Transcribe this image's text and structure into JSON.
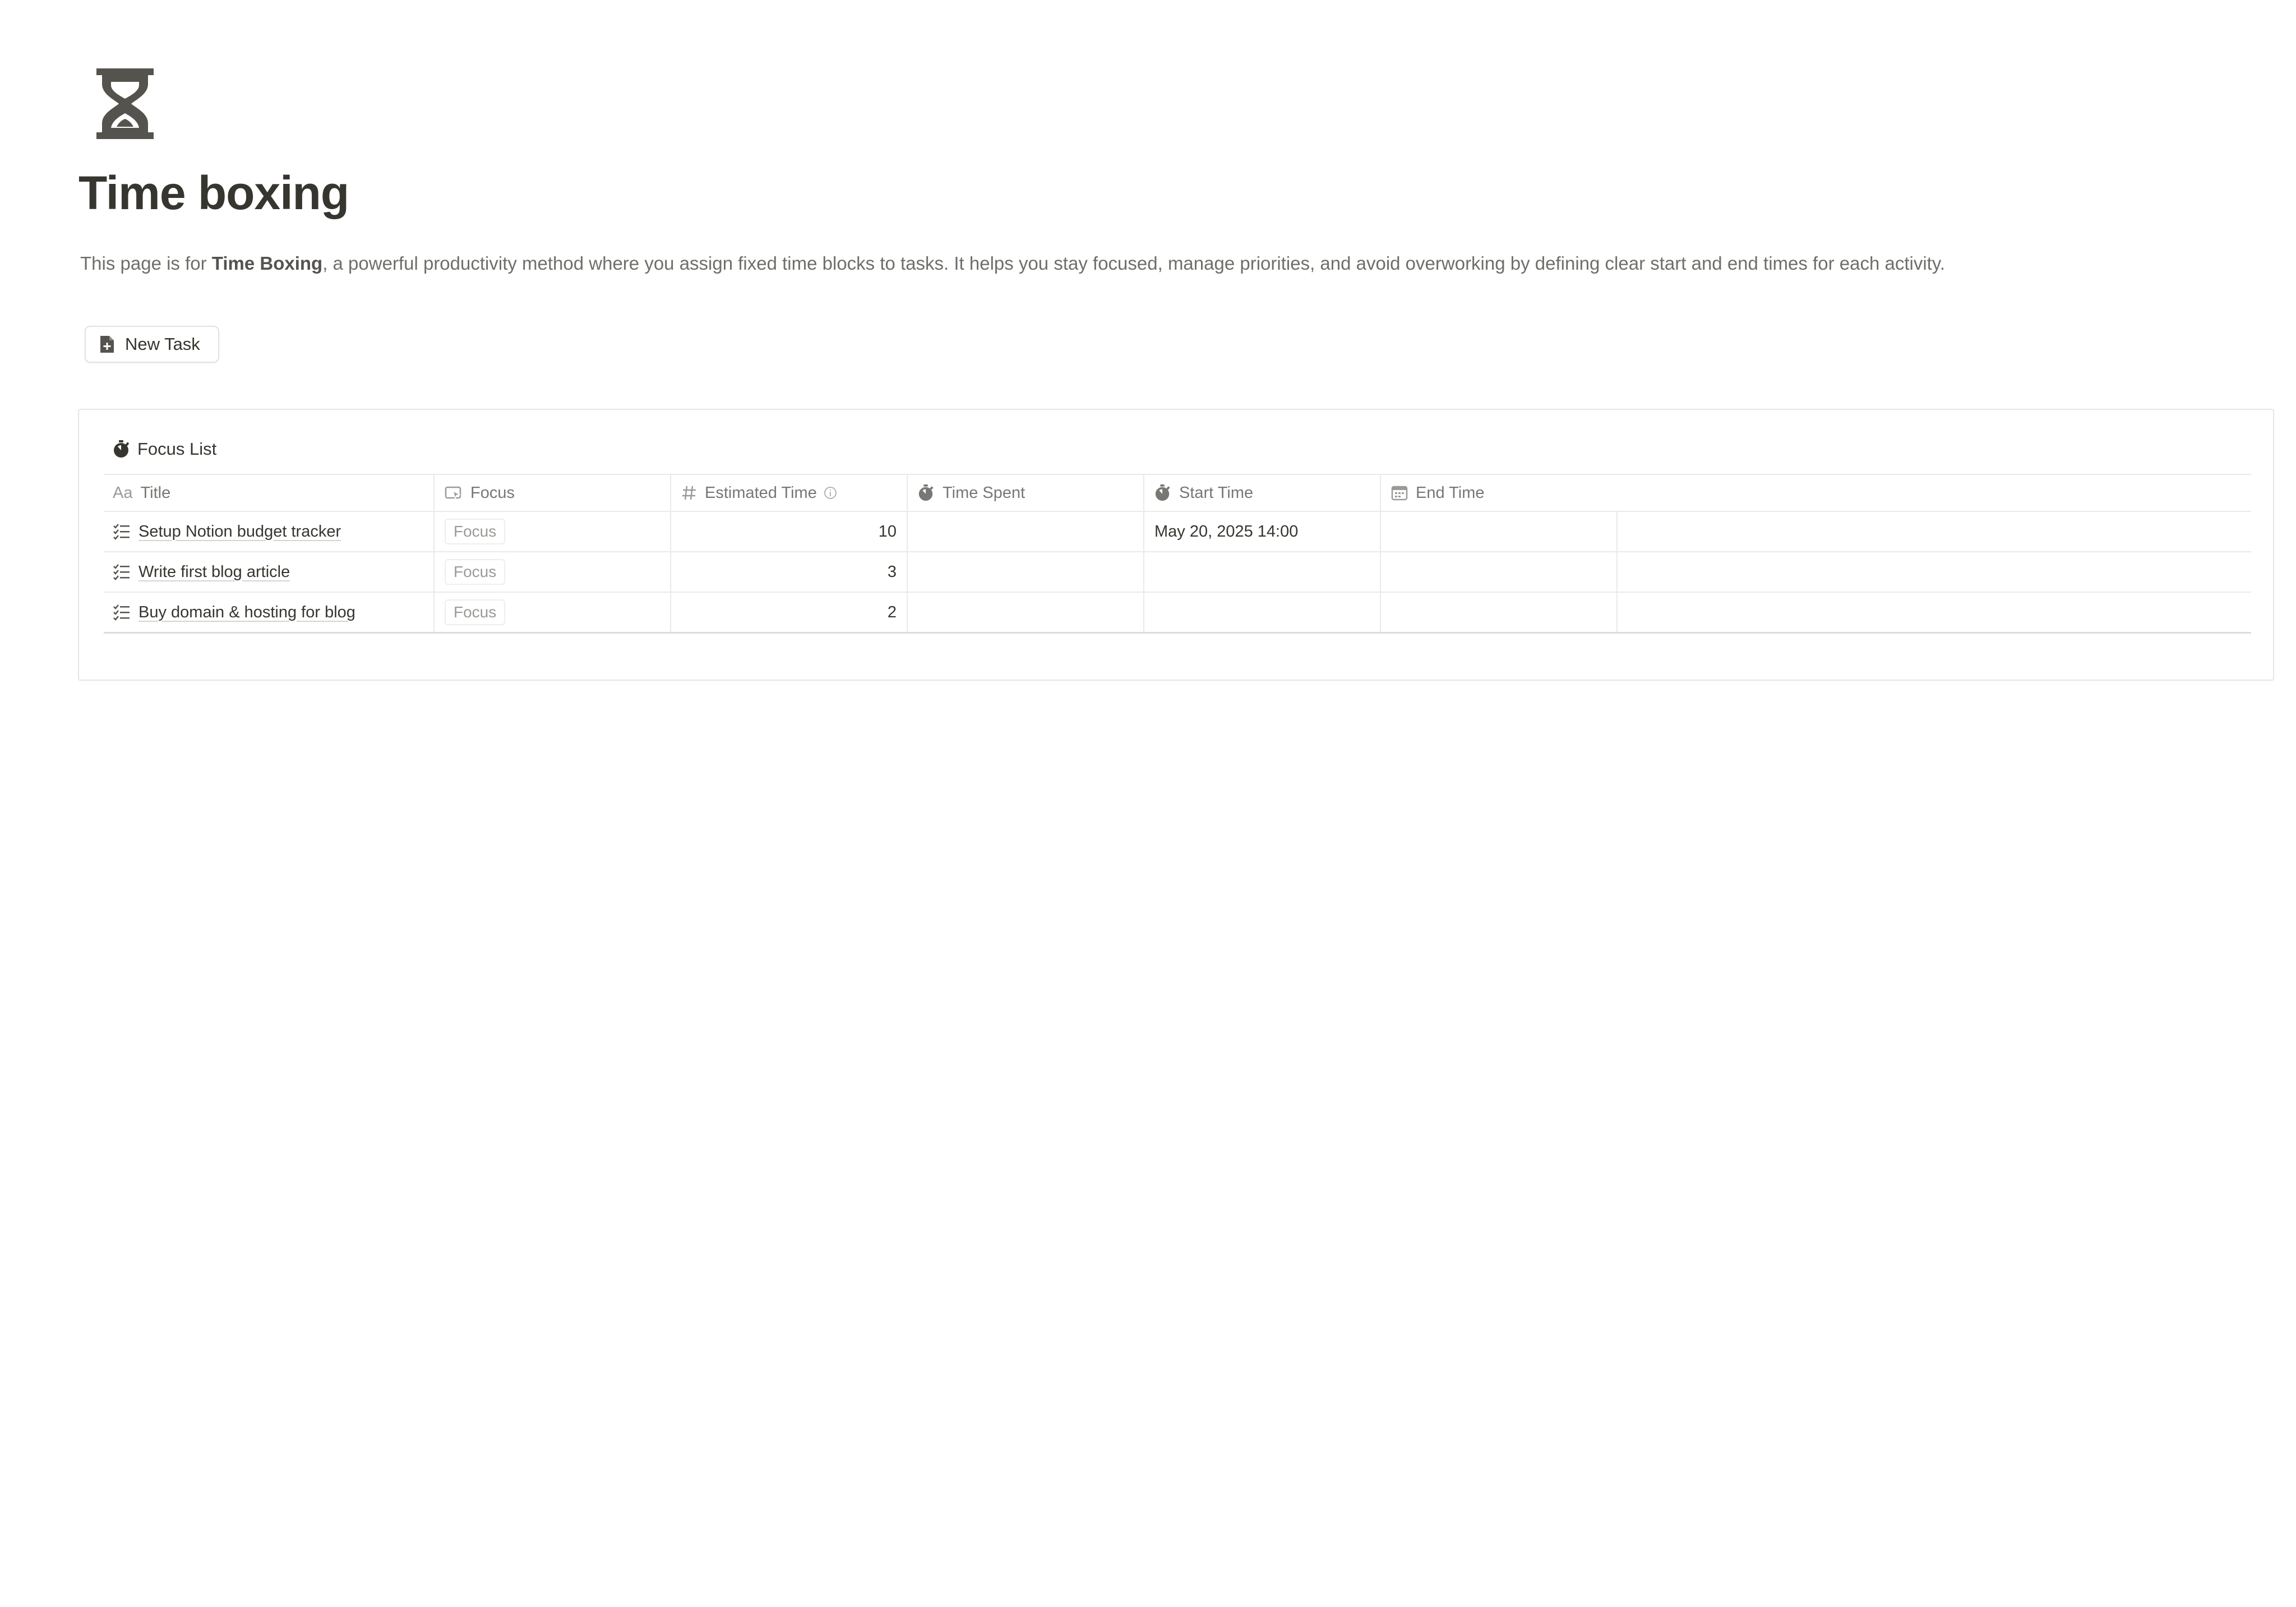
{
  "page": {
    "icon": "hourglass-icon",
    "title": "Time boxing",
    "description": {
      "prefix": "This page is for ",
      "bold": "Time Boxing",
      "suffix": ", a powerful productivity method where you assign fixed time blocks to tasks. It helps you stay focused, manage priorities, and avoid overworking by defining clear start and end times for each activity."
    }
  },
  "buttons": {
    "new_task": {
      "label": "New Task",
      "icon": "document-plus-icon"
    }
  },
  "database": {
    "title": "Focus List",
    "icon": "stopwatch-icon",
    "columns": {
      "title": {
        "label": "Title",
        "icon_text": "Aa"
      },
      "focus": {
        "label": "Focus",
        "icon": "button-cursor-icon"
      },
      "estimated_time": {
        "label": "Estimated Time",
        "icon": "hash-icon"
      },
      "time_spent": {
        "label": "Time Spent",
        "icon": "stopwatch-icon"
      },
      "start_time": {
        "label": "Start Time",
        "icon": "stopwatch-icon"
      },
      "end_time": {
        "label": "End Time",
        "icon": "calendar-icon"
      }
    },
    "rows": [
      {
        "title": "Setup Notion budget tracker",
        "focus": "Focus",
        "estimated_time": "10",
        "time_spent": "",
        "start_time": "May 20, 2025 14:00",
        "end_time": ""
      },
      {
        "title": "Write first blog article",
        "focus": "Focus",
        "estimated_time": "3",
        "time_spent": "",
        "start_time": "",
        "end_time": ""
      },
      {
        "title": "Buy domain & hosting for blog",
        "focus": "Focus",
        "estimated_time": "2",
        "time_spent": "",
        "start_time": "",
        "end_time": ""
      }
    ]
  },
  "colors": {
    "text": "#37352f",
    "muted": "#787774",
    "border": "#ebeae7",
    "icon": "#55534e"
  }
}
